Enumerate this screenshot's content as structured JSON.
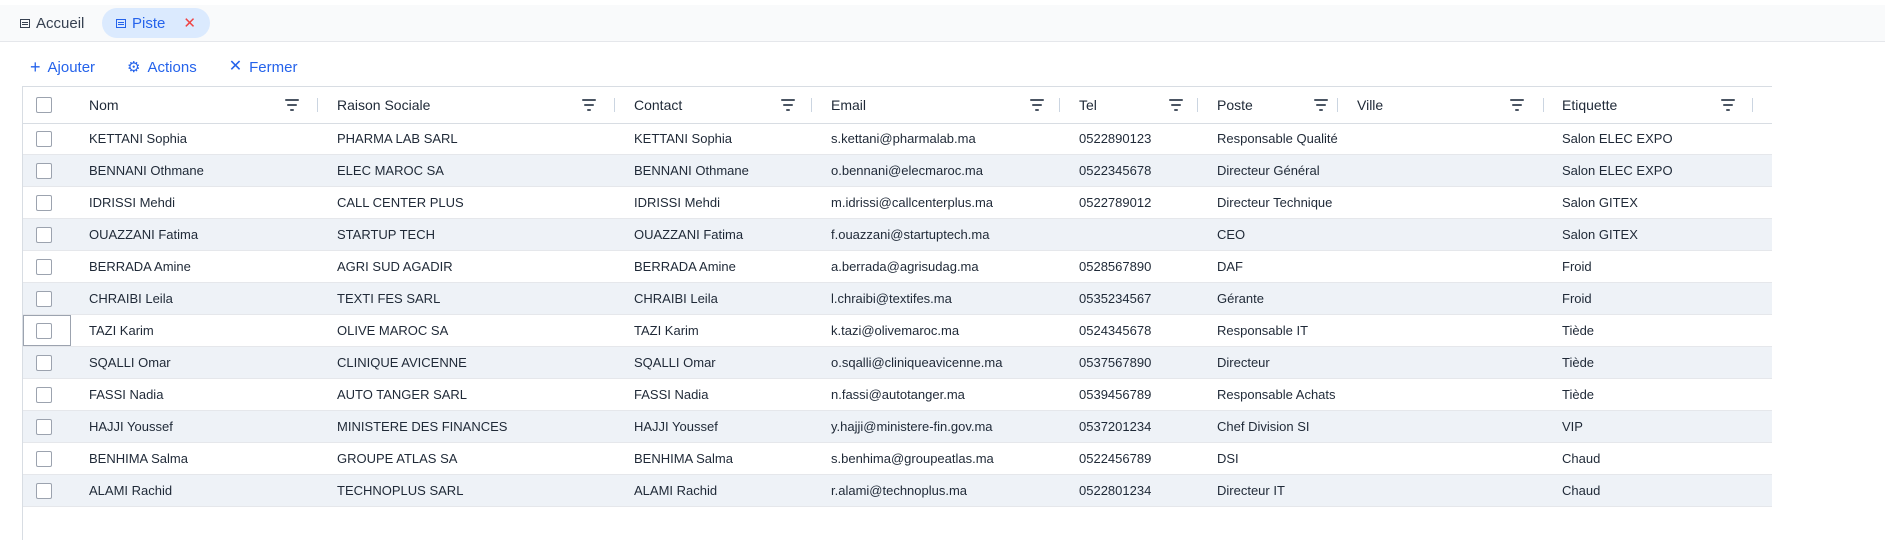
{
  "tabs": [
    {
      "label": "Accueil",
      "icon": "table-icon",
      "active": false
    },
    {
      "label": "Piste",
      "icon": "table-icon",
      "active": true,
      "close": "✕"
    }
  ],
  "toolbar": {
    "add": {
      "label": "Ajouter",
      "icon": "plus-icon"
    },
    "actions": {
      "label": "Actions",
      "icon": "gear-icon"
    },
    "close": {
      "label": "Fermer",
      "icon": "close-icon"
    }
  },
  "columns": [
    "Nom",
    "Raison Sociale",
    "Contact",
    "Email",
    "Tel",
    "Poste",
    "Ville",
    "Etiquette"
  ],
  "rows": [
    [
      "KETTANI Sophia",
      "PHARMA LAB SARL",
      "KETTANI Sophia",
      "s.kettani@pharmalab.ma",
      "0522890123",
      "Responsable Qualité",
      "",
      "Salon ELEC EXPO"
    ],
    [
      "BENNANI Othmane",
      "ELEC MAROC SA",
      "BENNANI Othmane",
      "o.bennani@elecmaroc.ma",
      "0522345678",
      "Directeur Général",
      "",
      "Salon ELEC EXPO"
    ],
    [
      "IDRISSI Mehdi",
      "CALL CENTER PLUS",
      "IDRISSI Mehdi",
      "m.idrissi@callcenterplus.ma",
      "0522789012",
      "Directeur Technique",
      "",
      "Salon GITEX"
    ],
    [
      "OUAZZANI Fatima",
      "STARTUP TECH",
      "OUAZZANI Fatima",
      "f.ouazzani@startuptech.ma",
      "",
      "CEO",
      "",
      "Salon GITEX"
    ],
    [
      "BERRADA Amine",
      "AGRI SUD AGADIR",
      "BERRADA Amine",
      "a.berrada@agrisudag.ma",
      "0528567890",
      "DAF",
      "",
      "Froid"
    ],
    [
      "CHRAIBI Leila",
      "TEXTI FES SARL",
      "CHRAIBI Leila",
      "l.chraibi@textifes.ma",
      "0535234567",
      "Gérante",
      "",
      "Froid"
    ],
    [
      "TAZI Karim",
      "OLIVE MAROC SA",
      "TAZI Karim",
      "k.tazi@olivemaroc.ma",
      "0524345678",
      "Responsable IT",
      "",
      "Tiède"
    ],
    [
      "SQALLI Omar",
      "CLINIQUE AVICENNE",
      "SQALLI Omar",
      "o.sqalli@cliniqueavicenne.ma",
      "0537567890",
      "Directeur",
      "",
      "Tiède"
    ],
    [
      "FASSI Nadia",
      "AUTO TANGER SARL",
      "FASSI Nadia",
      "n.fassi@autotanger.ma",
      "0539456789",
      "Responsable Achats",
      "",
      "Tiède"
    ],
    [
      "HAJJI Youssef",
      "MINISTERE DES FINANCES",
      "HAJJI Youssef",
      "y.hajji@ministere-fin.gov.ma",
      "0537201234",
      "Chef Division SI",
      "",
      "VIP"
    ],
    [
      "BENHIMA Salma",
      "GROUPE ATLAS SA",
      "BENHIMA Salma",
      "s.benhima@groupeatlas.ma",
      "0522456789",
      "DSI",
      "",
      "Chaud"
    ],
    [
      "ALAMI Rachid",
      "TECHNOPLUS SARL",
      "ALAMI Rachid",
      "r.alami@technoplus.ma",
      "0522801234",
      "Directeur IT",
      "",
      "Chaud"
    ]
  ],
  "colors": {
    "accent": "#2563eb",
    "active_tab_bg": "#dbeafe",
    "alt_row": "#eef2f7",
    "close_x": "#ef4444"
  }
}
